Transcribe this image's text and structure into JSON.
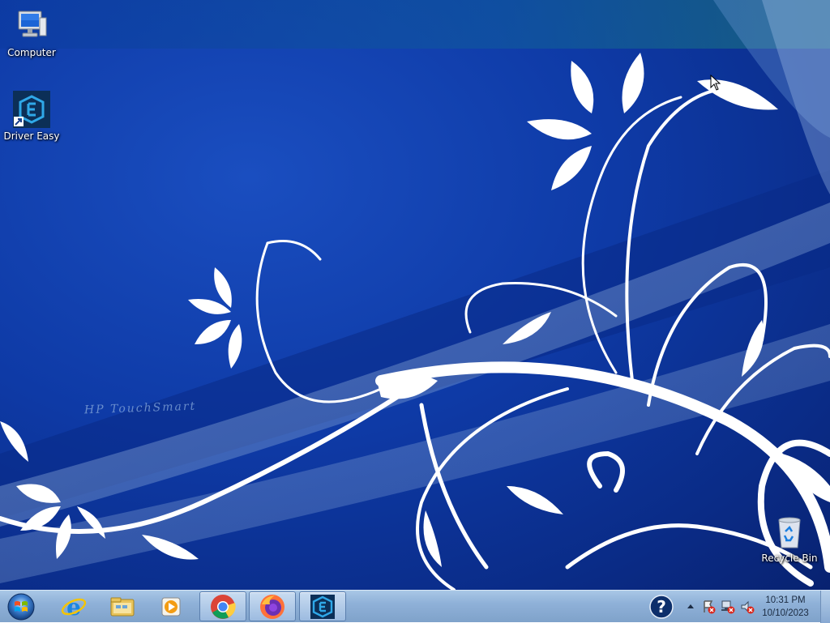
{
  "desktop": {
    "icons": [
      {
        "label": "Computer",
        "icon": "computer-icon"
      },
      {
        "label": "Driver Easy",
        "icon": "driver-easy-icon"
      },
      {
        "label": "Recycle Bin",
        "icon": "recycle-bin-icon"
      }
    ],
    "wallpaper": {
      "watermark": "HP TouchSmart",
      "base_color": "#0e3aa6"
    }
  },
  "taskbar": {
    "start": {
      "icon": "windows-start-icon"
    },
    "pinned": [
      {
        "icon": "internet-explorer-icon",
        "active": false
      },
      {
        "icon": "file-explorer-icon",
        "active": false
      },
      {
        "icon": "media-player-icon",
        "active": false
      },
      {
        "icon": "chrome-icon",
        "active": true
      },
      {
        "icon": "firefox-icon",
        "active": true
      },
      {
        "icon": "driver-easy-icon",
        "active": true
      }
    ],
    "tray": {
      "help_icon": "help-icon",
      "icons": [
        "show-hidden-icons-arrow",
        "action-center-alert-icon",
        "network-alert-icon",
        "volume-muted-icon"
      ]
    },
    "clock": {
      "time": "10:31 PM",
      "date": "10/10/2023"
    }
  },
  "colors": {
    "taskbar": "#8fb1d8",
    "accent": "#1a9fe0"
  }
}
